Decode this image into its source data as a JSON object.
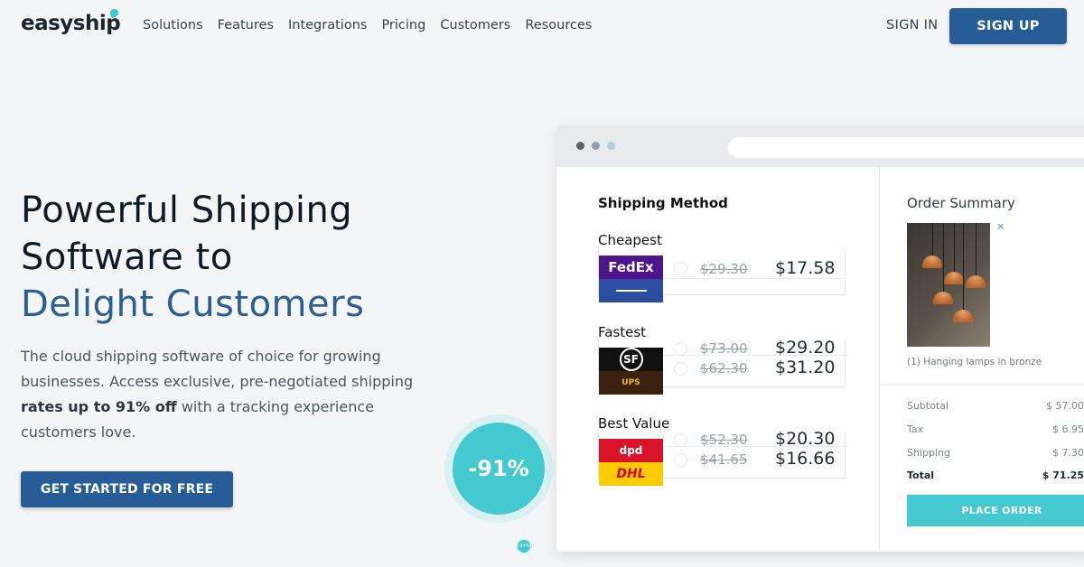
{
  "nav": {
    "logo": "easyship",
    "links": [
      "Solutions",
      "Features",
      "Integrations",
      "Pricing",
      "Customers",
      "Resources"
    ],
    "sign_in": "SIGN IN",
    "sign_up": "SIGN UP"
  },
  "hero": {
    "headline_line1": "Powerful Shipping",
    "headline_line2": "Software to",
    "headline_accent": "Delight Customers",
    "sub_pre": "The cloud shipping software of choice for growing businesses. Access exclusive, pre-negotiated shipping ",
    "sub_bold": "rates up to 91% off",
    "sub_post": " with a tracking experience customers love.",
    "cta": "GET STARTED FOR FREE",
    "badge": "-91%",
    "mini_badge": "-91%"
  },
  "mock": {
    "shipping_title": "Shipping Method",
    "groups": [
      {
        "label": "Cheapest",
        "rates": [
          {
            "carrier": "FedEx",
            "carrier_icon": "fedex-logo",
            "old": "$29.30",
            "new": "$17.58",
            "color": "#4d148c"
          },
          {
            "carrier": "",
            "carrier_icon": "usps-logo",
            "old": "",
            "new": "",
            "color": "#2b4ea1"
          }
        ]
      },
      {
        "label": "Fastest",
        "rates": [
          {
            "carrier": "SF",
            "carrier_icon": "sf-express-logo",
            "old": "$73.00",
            "new": "$29.20",
            "color": "#111111"
          },
          {
            "carrier": "UPS",
            "carrier_icon": "ups-logo",
            "old": "$62.30",
            "new": "$31.20",
            "color": "#3b2210"
          }
        ]
      },
      {
        "label": "Best Value",
        "rates": [
          {
            "carrier": "dpd",
            "carrier_icon": "dpd-logo",
            "old": "$52.30",
            "new": "$20.30",
            "color": "#d9142a"
          },
          {
            "carrier": "DHL",
            "carrier_icon": "dhl-logo",
            "old": "$41.65",
            "new": "$16.66",
            "color": "#ffcc00"
          }
        ]
      }
    ],
    "order_title": "Order Summary",
    "remove": "×",
    "item_caption": "(1) Hanging lamps in bronze",
    "summary": [
      {
        "label": "Subtotal",
        "value": "$ 57.00"
      },
      {
        "label": "Tax",
        "value": "$ 6.95"
      },
      {
        "label": "Shipping",
        "value": "$ 7.30"
      },
      {
        "label": "Total",
        "value": "$ 71.25"
      }
    ],
    "place_order": "PLACE ORDER"
  }
}
